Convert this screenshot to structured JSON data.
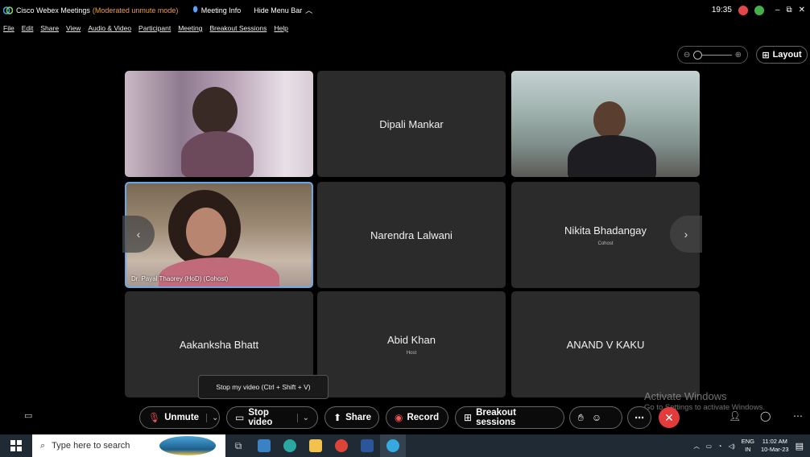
{
  "window": {
    "app_name": "Cisco Webex Meetings",
    "mode": "(Moderated unmute mode)",
    "meeting_info": "Meeting Info",
    "hide_menu": "Hide Menu Bar",
    "time": "19:35"
  },
  "menu": [
    "File",
    "Edit",
    "Share",
    "View",
    "Audio & Video",
    "Participant",
    "Meeting",
    "Breakout Sessions",
    "Help"
  ],
  "layout_button": "Layout",
  "tiles": [
    {
      "name": "",
      "role": "",
      "label": ""
    },
    {
      "name": "Dipali Mankar",
      "role": ""
    },
    {
      "name": "",
      "role": ""
    },
    {
      "name": "",
      "role": "",
      "label": "Dr. Payal Thaorey (HoD) (Cohost)"
    },
    {
      "name": "Narendra Lalwani",
      "role": ""
    },
    {
      "name": "Nikita Bhadangay",
      "role": "Cohost"
    },
    {
      "name": "Aakanksha Bhatt",
      "role": ""
    },
    {
      "name": "Abid Khan",
      "role": "Host"
    },
    {
      "name": "ANAND V KAKU",
      "role": ""
    }
  ],
  "tooltip": "Stop my video (Ctrl + Shift + V)",
  "controls": {
    "unmute": "Unmute",
    "stop_video": "Stop video",
    "share": "Share",
    "record": "Record",
    "breakout": "Breakout sessions"
  },
  "watermark": {
    "line1": "Activate Windows",
    "line2": "Go to Settings to activate Windows."
  },
  "taskbar": {
    "search_placeholder": "Type here to search",
    "lang": "ENG",
    "region": "IN",
    "time": "11:02 AM",
    "date": "10-Mar-23"
  },
  "colors": {
    "accent_border": "#6aa9e9",
    "end_button": "#e33b3b",
    "mode_text": "#f0a030"
  }
}
